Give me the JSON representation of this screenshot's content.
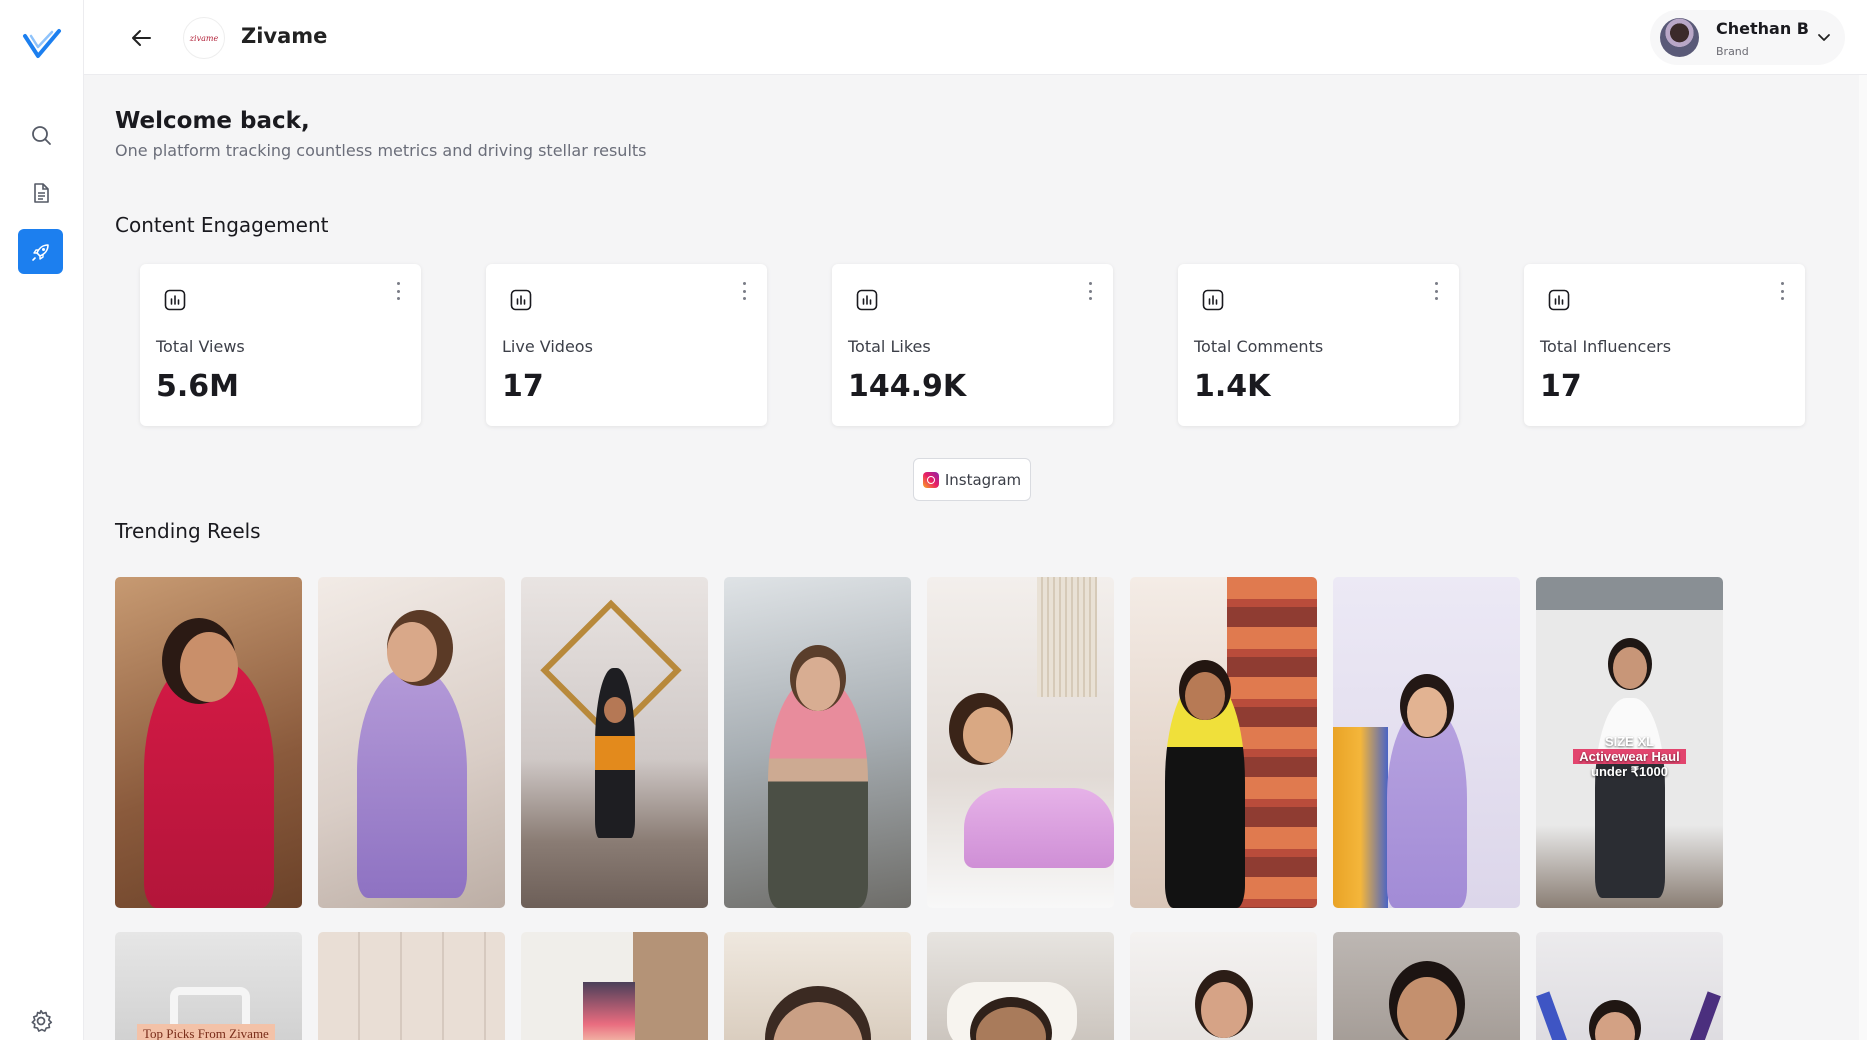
{
  "header": {
    "brand_name": "Zivame",
    "brand_logo_text": "zivame",
    "user": {
      "name": "Chethan B",
      "role": "Brand"
    }
  },
  "welcome": {
    "title": "Welcome back,",
    "subtitle": "One platform tracking countless metrics and driving stellar results"
  },
  "engagement": {
    "title": "Content Engagement",
    "cards": [
      {
        "label": "Total Views",
        "value": "5.6M"
      },
      {
        "label": "Live Videos",
        "value": "17"
      },
      {
        "label": "Total Likes",
        "value": "144.9K"
      },
      {
        "label": "Total Comments",
        "value": "1.4K"
      },
      {
        "label": "Total Influencers",
        "value": "17"
      }
    ],
    "platform": "Instagram"
  },
  "trending": {
    "title": "Trending Reels",
    "reel_overlay": {
      "line1": "SIZE XL",
      "line2": "Activewear Haul",
      "line3": "under ₹1000"
    },
    "row2_tag": "Top Picks From Zivame"
  },
  "colors": {
    "accent": "#1c7fef",
    "background": "#f5f5f6"
  }
}
